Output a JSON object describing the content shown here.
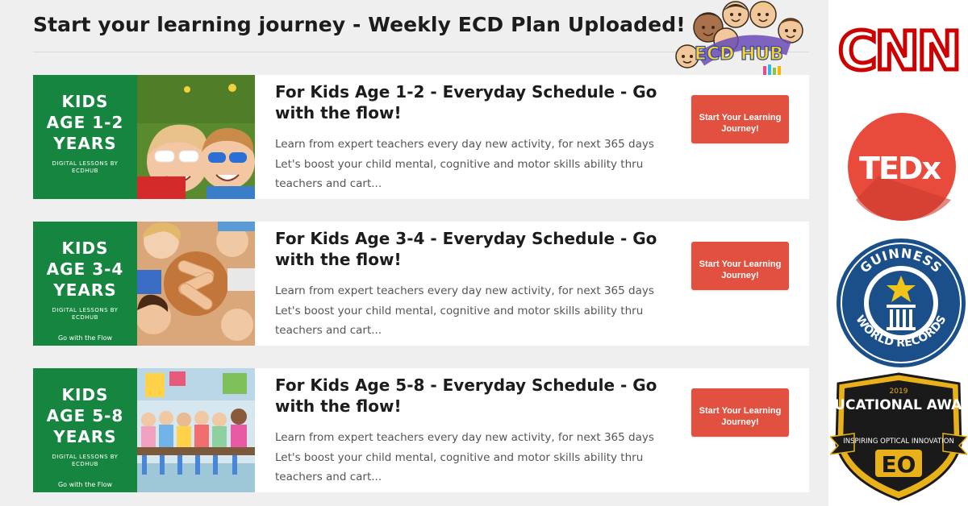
{
  "page": {
    "title": "Start your learning journey - Weekly ECD Plan Uploaded!",
    "brand_logo_text": "ECD HUB"
  },
  "courses": [
    {
      "thumb_lines": [
        "KIDS",
        "AGE 1-2",
        "YEARS"
      ],
      "thumb_sub": "DIGITAL LESSONS BY ECDHUB",
      "thumb_flow": "",
      "title": "For Kids Age 1-2 - Everyday Schedule - Go with the flow!",
      "desc_line1": "Learn from expert teachers every day new activity, for next 365 days",
      "desc_line2": "Let's boost your child mental, cognitive and motor skills ability thru",
      "desc_line3": "teachers and cart...",
      "cta": "Start Your Learning Journey!"
    },
    {
      "thumb_lines": [
        "KIDS",
        "AGE 3-4",
        "YEARS"
      ],
      "thumb_sub": "DIGITAL LESSONS BY ECDHUB",
      "thumb_flow": "Go with the Flow",
      "title": "For Kids Age 3-4 - Everyday Schedule - Go with the flow!",
      "desc_line1": "Learn from expert teachers every day new activity, for next 365 days",
      "desc_line2": "Let's boost your child mental, cognitive and motor skills ability thru",
      "desc_line3": "teachers and cart...",
      "cta": "Start Your Learning Journey!"
    },
    {
      "thumb_lines": [
        "KIDS",
        "AGE 5-8",
        "YEARS"
      ],
      "thumb_sub": "DIGITAL LESSONS BY ECDHUB",
      "thumb_flow": "Go with the Flow",
      "title": "For Kids Age 5-8 - Everyday Schedule - Go with the flow!",
      "desc_line1": "Learn from expert teachers every day new activity, for next 365 days",
      "desc_line2": "Let's boost your child mental, cognitive and motor skills ability thru",
      "desc_line3": "teachers and cart...",
      "cta": "Start Your Learning Journey!"
    }
  ],
  "press": {
    "cnn": "CNN",
    "tedx": "TEDx",
    "guinness": "GUINNESS WORLD RECORDS",
    "award_year": "2019",
    "award_title": "EDUCATIONAL AWARD",
    "award_sub": "INSPIRING OPTICAL INNOVATION",
    "award_mark": "EO"
  },
  "colors": {
    "green": "#15853f",
    "cta": "#e2513f",
    "cnn": "#cc0000",
    "tedx": "#e84b3c",
    "guinness": "#1a4f8a",
    "award_gold": "#e8b11a"
  }
}
